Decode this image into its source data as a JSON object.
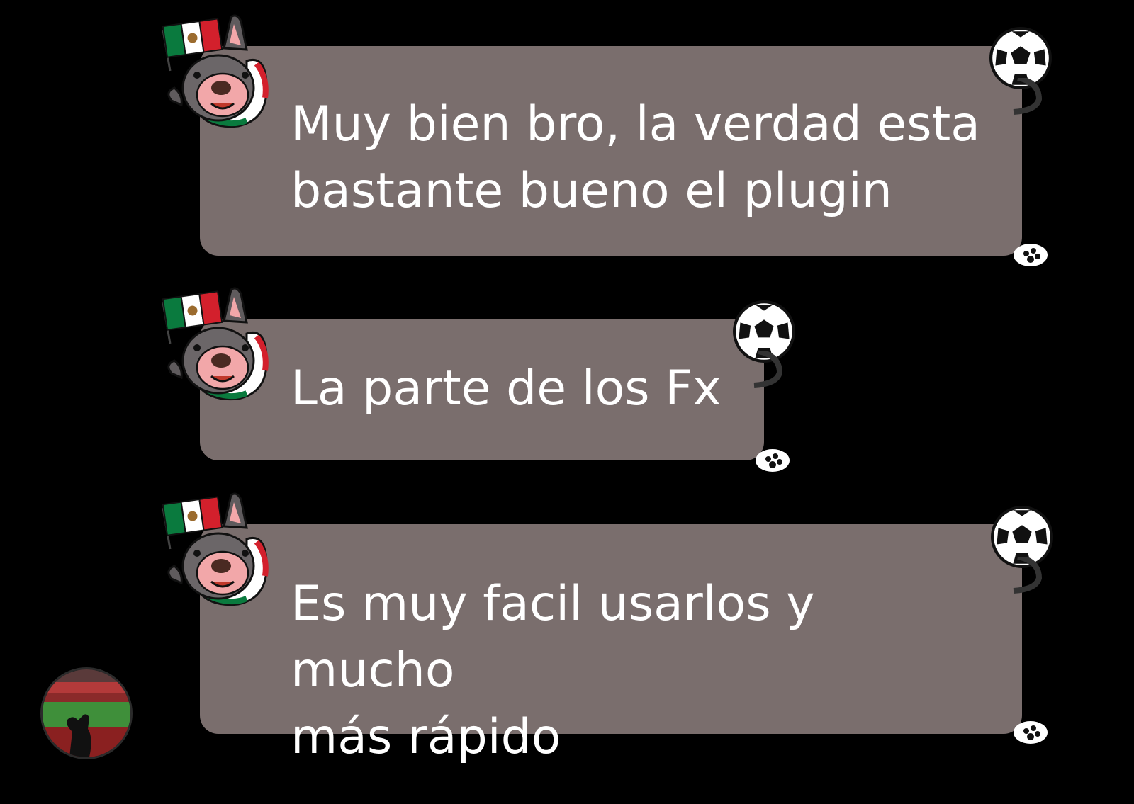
{
  "messages": [
    {
      "text_lines": [
        "Muy bien bro, la verdad esta",
        "bastante bueno el plugin"
      ]
    },
    {
      "text_lines": [
        "La parte de los Fx"
      ]
    },
    {
      "text_lines": [
        "Es muy facil usarlos y mucho",
        "más rápido"
      ]
    }
  ],
  "colors": {
    "background": "#000000",
    "bubble": "#7a6e6d",
    "text": "#ffffff",
    "flag_green": "#0a7a3e",
    "flag_red": "#d3202c"
  },
  "icons": [
    "mexican-flag-icon",
    "bulldog-sticker-icon",
    "soccer-ball-icon",
    "paw-icon",
    "avatar"
  ]
}
